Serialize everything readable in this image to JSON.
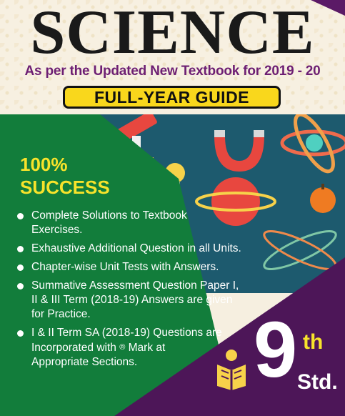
{
  "cover": {
    "title": "SCIENCE",
    "subtitle": "As per the Updated New Textbook for 2019 - 20",
    "guide_label": "FULL-YEAR GUIDE",
    "success_line1": "100%",
    "success_line2": "SUCCESS",
    "features": [
      "Complete Solutions to Textbook Exercises.",
      "Exhaustive Additional Question in all Units.",
      "Chapter-wise Unit Tests with Answers.",
      "Summative Assessment Question Paper I, II & III Term (2018-19) Answers are given for Practice.",
      "I & II Term SA (2018-19) Questions are Incorporated with"
    ],
    "feature5_symbol": "®",
    "feature5_tail": "Mark at Appropriate Sections.",
    "standard_number": "9",
    "standard_suffix": "th",
    "standard_label": "Std."
  },
  "colors": {
    "green": "#127d3b",
    "purple": "#4d1658",
    "yellow": "#f9d71c",
    "teal": "#1d5a6e"
  },
  "icons": [
    "microscope-icon",
    "magnet-icon",
    "atom-icon",
    "bulb-icon",
    "planet-icon",
    "apple-icon",
    "book-reader-icon"
  ]
}
